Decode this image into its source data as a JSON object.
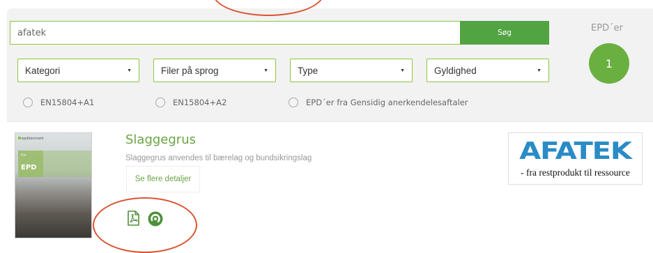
{
  "search": {
    "value": "afatek",
    "button_label": "Søg"
  },
  "epd_count": {
    "label": "EPD´er",
    "value": "1"
  },
  "filters": [
    {
      "label": "Kategori"
    },
    {
      "label": "Filer på sprog"
    },
    {
      "label": "Type"
    },
    {
      "label": "Gyldighed"
    }
  ],
  "radios": [
    {
      "label": "EN15804+A1"
    },
    {
      "label": "EN15804+A2"
    },
    {
      "label": "EPD´er fra Gensidig anerkendelesaftaler"
    }
  ],
  "result": {
    "title": "Slaggegrus",
    "description": "Slaggegrus anvendes til bærelag og bundsikringslag",
    "details_label": "Se flere detaljer",
    "cover": {
      "brand": "epddanmark",
      "small_text": "Kle",
      "epd": "EPD"
    },
    "icons": [
      "pdf-icon",
      "recycle-icon"
    ],
    "logo": {
      "word": "AFATEK",
      "tagline": "- fra restprodukt til ressource"
    }
  },
  "colors": {
    "green": "#52a442",
    "accent_green": "#6aa444",
    "logo_blue": "#2a8bc6",
    "annotation": "#d9532f"
  }
}
